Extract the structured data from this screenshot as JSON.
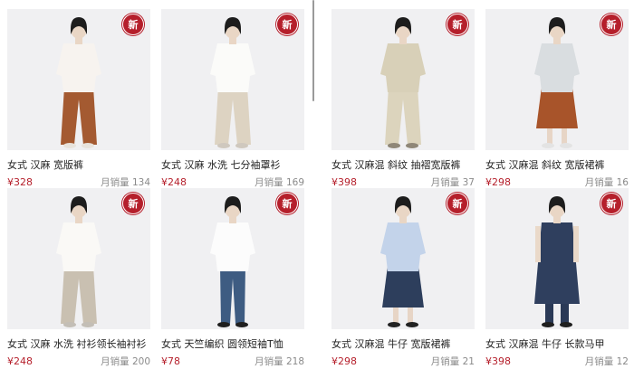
{
  "badge_text": "新",
  "sales_label": "月销量",
  "products": [
    {
      "name": "女式 汉麻 宽版裤",
      "price": "¥328",
      "sales": "134",
      "top": "#f7f3ef",
      "bottom": "#a45a31",
      "shoe": "#e8e3dc",
      "hair": "#1d1d1d",
      "style": "wide"
    },
    {
      "name": "女式 汉麻 水洗 七分袖罩衫",
      "price": "¥248",
      "sales": "169",
      "top": "#fbfbf9",
      "bottom": "#ddd3c2",
      "shoe": "#cfc8be",
      "hair": "#1d1d1d",
      "style": "wide"
    },
    {
      "name": "女式 汉麻混 斜纹 抽褶宽版裤",
      "price": "¥398",
      "sales": "37",
      "top": "#d8d0b8",
      "bottom": "#dcd4bd",
      "shoe": "#8f8778",
      "hair": "#1d1d1d",
      "style": "set"
    },
    {
      "name": "女式 汉麻混 斜纹 宽版裙裤",
      "price": "¥298",
      "sales": "16",
      "top": "#d9dde0",
      "bottom": "#a8542a",
      "shoe": "#e3e3e3",
      "hair": "#1d1d1d",
      "style": "culotte"
    },
    {
      "name": "女式 汉麻 水洗 衬衫领长袖衬衫",
      "price": "¥248",
      "sales": "200",
      "top": "#faf9f6",
      "bottom": "#c9c0b1",
      "shoe": "#c3beb6",
      "hair": "#1d1d1d",
      "style": "wide"
    },
    {
      "name": "女式 天竺编织 圆领短袖T恤",
      "price": "¥78",
      "sales": "218",
      "top": "#fcfcfc",
      "bottom": "#3e5c82",
      "shoe": "#1f1f1f",
      "hair": "#1d1d1d",
      "style": "slim"
    },
    {
      "name": "女式 汉麻混 牛仔 宽版裙裤",
      "price": "¥298",
      "sales": "21",
      "top": "#c3d3ea",
      "bottom": "#2d3e5c",
      "shoe": "#222222",
      "hair": "#1d1d1d",
      "style": "culotte"
    },
    {
      "name": "女式 汉麻混 牛仔 长款马甲",
      "price": "¥398",
      "sales": "12",
      "top": "#2f3f5e",
      "bottom": "#2b3a57",
      "shoe": "#1f1f1f",
      "hair": "#1d1d1d",
      "style": "vest"
    }
  ]
}
